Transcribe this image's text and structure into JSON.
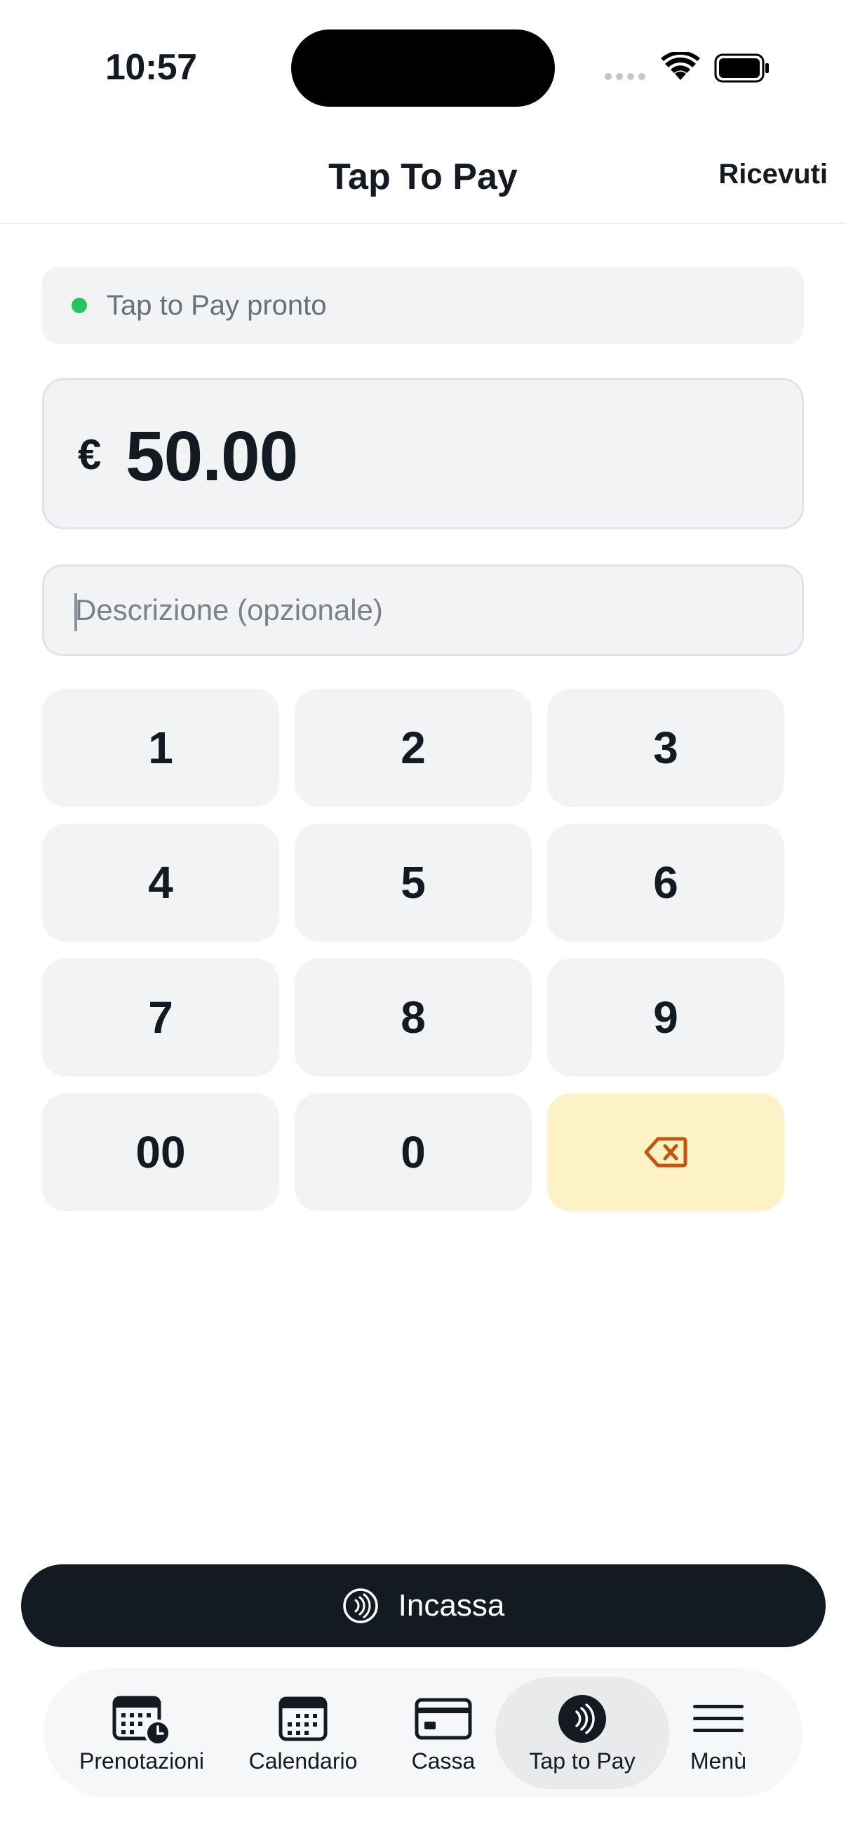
{
  "status_bar": {
    "time": "10:57"
  },
  "nav": {
    "title": "Tap To Pay",
    "right_action": "Ricevuti"
  },
  "reader_status": {
    "text": "Tap to Pay pronto",
    "indicator_color": "#22c55e"
  },
  "amount": {
    "currency": "€",
    "value": "50.00"
  },
  "description": {
    "value": "",
    "placeholder": "Descrizione (opzionale)"
  },
  "keypad": {
    "keys": [
      "1",
      "2",
      "3",
      "4",
      "5",
      "6",
      "7",
      "8",
      "9",
      "00",
      "0"
    ],
    "delete_icon": "backspace-icon",
    "delete_color": "#c2560c"
  },
  "charge_button": {
    "label": "Incassa",
    "icon": "contactless-icon"
  },
  "tabs": [
    {
      "label": "Prenotazioni",
      "icon": "calendar-clock-icon"
    },
    {
      "label": "Calendario",
      "icon": "calendar-icon"
    },
    {
      "label": "Cassa",
      "icon": "credit-card-icon"
    },
    {
      "label": "Tap to Pay",
      "icon": "contactless-icon",
      "active": true
    },
    {
      "label": "Menù",
      "icon": "menu-icon"
    }
  ]
}
